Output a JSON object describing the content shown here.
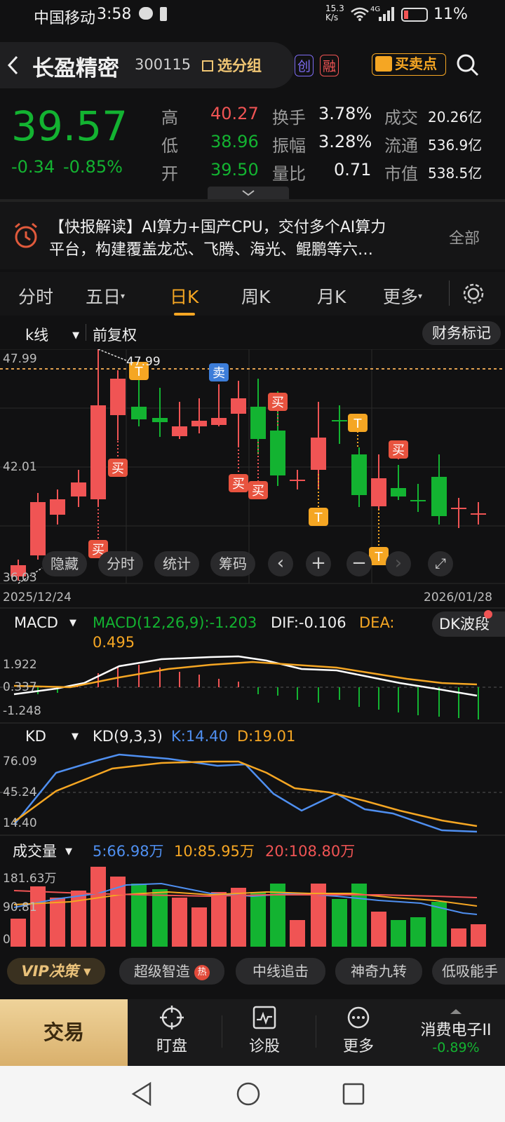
{
  "status": {
    "carrier": "中国移动",
    "time": "3:58",
    "speed_top": "15.3",
    "speed_bot": "K/s",
    "net": "4G",
    "battery": "11%"
  },
  "header": {
    "name": "长盈精密",
    "code": "300115",
    "group": "选分组",
    "badge1": "创",
    "badge2": "融",
    "bsp": "买卖点"
  },
  "quote": {
    "price": "39.57",
    "change": "-0.34",
    "pct": "-0.85%",
    "high_label": "高",
    "high": "40.27",
    "low_label": "低",
    "low": "38.96",
    "open_label": "开",
    "open": "39.50",
    "turnover_label": "换手",
    "turnover": "3.78%",
    "amp_label": "振幅",
    "amp": "3.28%",
    "vr_label": "量比",
    "vr": "0.71",
    "vol_label": "成交",
    "vol": "20.26亿",
    "float_label": "流通",
    "float": "536.9亿",
    "mcap_label": "市值",
    "mcap": "538.5亿"
  },
  "news": {
    "line1": "【快报解读】AI算力+国产CPU，交付多个AI算力",
    "line2": "平台，构建覆盖龙芯、飞腾、海光、鲲鹏等六…",
    "more": "全部"
  },
  "tabs": [
    "分时",
    "五日",
    "日K",
    "周K",
    "月K",
    "更多"
  ],
  "kline": {
    "type": "k线",
    "adjust": "前复权",
    "finance": "财务标记",
    "y_high": "47.99",
    "y_mid": "42.01",
    "y_low": "36.03",
    "high_marker": "47.99",
    "date_start": "2025/12/24",
    "date_end": "2026/01/28",
    "signals": {
      "buy": "买",
      "sell": "卖",
      "t": "T"
    }
  },
  "tools": {
    "hide": "隐藏",
    "intraday": "分时",
    "stats": "统计",
    "chips": "筹码"
  },
  "macd": {
    "name": "MACD",
    "params": "MACD(12,26,9):-1.203",
    "dif": "DIF:-0.106",
    "dea_label": "DEA:",
    "dea": "0.495",
    "dk": "DK波段",
    "y1": "1.922",
    "y2": "0.337",
    "y3": "-1.248"
  },
  "kd": {
    "name": "KD",
    "params": "KD(9,3,3)",
    "k": "K:14.40",
    "d": "D:19.01",
    "y1": "76.09",
    "y2": "45.24",
    "y3": "14.40"
  },
  "volume": {
    "name": "成交量",
    "ma5": "5:66.98万",
    "ma10": "10:85.95万",
    "ma20": "20:108.80万",
    "y1": "181.63万",
    "y2": "90.81",
    "y3": "0"
  },
  "strategies": [
    "VIP决策",
    "超级智造",
    "中线追击",
    "神奇九转",
    "低吸能手"
  ],
  "hot": "热",
  "nav": {
    "trade": "交易",
    "watch": "盯盘",
    "diagnose": "诊股",
    "more": "更多",
    "sector": "消费电子II",
    "sector_pct": "-0.89%"
  },
  "colors": {
    "up": "#f05454",
    "down": "#13b331",
    "bg": "#111112",
    "accent": "#f5a623"
  }
}
